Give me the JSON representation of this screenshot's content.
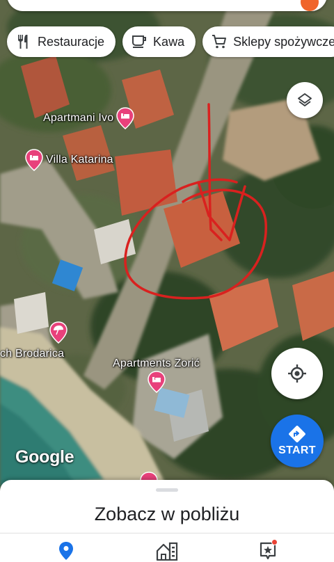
{
  "chips": [
    {
      "label": "Restauracje",
      "icon": "fork-knife-icon"
    },
    {
      "label": "Kawa",
      "icon": "coffee-cup-icon"
    },
    {
      "label": "Sklepy spożywcze",
      "icon": "shopping-cart-icon"
    }
  ],
  "map": {
    "pois": [
      {
        "label": "Apartmani Ivo",
        "icon": "hotel-bed-icon"
      },
      {
        "label": "Villa Katarina",
        "icon": "hotel-bed-icon"
      },
      {
        "label": "Apartments Zorić",
        "icon": "hotel-bed-icon"
      },
      {
        "label": "ch Brodarica",
        "icon": "beach-umbrella-icon"
      }
    ],
    "pin_color": "#e8417b",
    "annotation_color": "#d9211f",
    "attribution": "Google"
  },
  "buttons": {
    "layers_icon": "layers-icon",
    "locate_icon": "my-location-icon",
    "start_label": "START",
    "start_color": "#1a73e8"
  },
  "bottom_sheet": {
    "title": "Zobacz w pobliżu"
  },
  "bottom_nav": [
    {
      "icon": "explore-pin-icon",
      "active": true
    },
    {
      "icon": "commute-building-icon",
      "active": false
    },
    {
      "icon": "updates-icon",
      "active": false,
      "badge": true
    }
  ]
}
